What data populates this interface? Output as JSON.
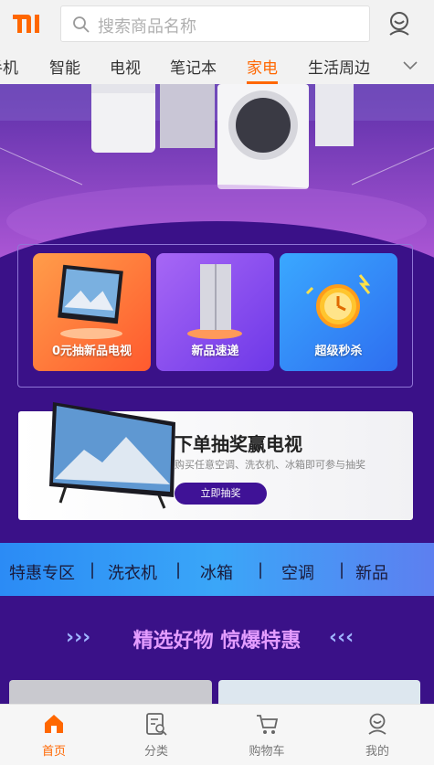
{
  "header": {
    "logo_icon": "mi-logo-icon",
    "search_placeholder": "搜索商品名称",
    "user_icon": "user-icon"
  },
  "categories": {
    "items": [
      "手机",
      "智能",
      "电视",
      "笔记本",
      "家电",
      "生活周边"
    ],
    "active_index": 4,
    "more_icon": "chevron-down-icon"
  },
  "promos": [
    {
      "label": "0元抽新品电视",
      "icon": "tv-icon",
      "color": "#ff7a3a"
    },
    {
      "label": "新品速递",
      "icon": "fridge-icon",
      "color": "#8a4df0"
    },
    {
      "label": "超级秒杀",
      "icon": "alarm-clock-icon",
      "color": "#2f86f6"
    }
  ],
  "draw_banner": {
    "title": "下单抽奖赢电视",
    "subtitle": "购买任意空调、洗衣机、冰箱即可参与抽奖",
    "button": "立即抽奖"
  },
  "strip": {
    "items": [
      "特惠专区",
      "洗衣机",
      "冰箱",
      "空调",
      "新品"
    ]
  },
  "section_title": "精选好物 惊爆特惠",
  "tabbar": {
    "items": [
      {
        "label": "首页",
        "icon": "home-icon"
      },
      {
        "label": "分类",
        "icon": "category-icon"
      },
      {
        "label": "购物车",
        "icon": "cart-icon"
      },
      {
        "label": "我的",
        "icon": "user-icon"
      }
    ],
    "active_index": 0
  },
  "colors": {
    "accent": "#ff6700",
    "header_bg": "#f2f2f2",
    "main_bg": "#3a1188"
  }
}
